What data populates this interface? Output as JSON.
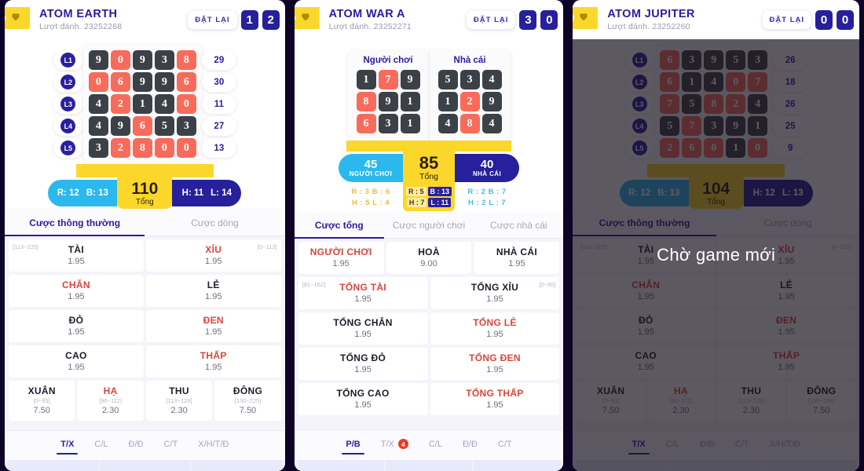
{
  "panels": [
    {
      "id": "atom-earth",
      "header": {
        "title": "ATOM EARTH",
        "subtitle": "Lượt đánh. 23252268",
        "reset_label": "ĐẶT LẠI",
        "score_left": "1",
        "score_right": "2"
      },
      "board": {
        "type": "grid5",
        "row_labels": [
          "L1",
          "L2",
          "L3",
          "L4",
          "L5"
        ],
        "rows": [
          {
            "cells": [
              {
                "v": "9",
                "c": "dark"
              },
              {
                "v": "0",
                "c": "red"
              },
              {
                "v": "9",
                "c": "dark"
              },
              {
                "v": "3",
                "c": "dark"
              },
              {
                "v": "8",
                "c": "red"
              }
            ],
            "sum": "29"
          },
          {
            "cells": [
              {
                "v": "0",
                "c": "red"
              },
              {
                "v": "6",
                "c": "red"
              },
              {
                "v": "9",
                "c": "dark"
              },
              {
                "v": "9",
                "c": "dark"
              },
              {
                "v": "6",
                "c": "red"
              }
            ],
            "sum": "30"
          },
          {
            "cells": [
              {
                "v": "4",
                "c": "dark"
              },
              {
                "v": "2",
                "c": "red"
              },
              {
                "v": "1",
                "c": "dark"
              },
              {
                "v": "4",
                "c": "dark"
              },
              {
                "v": "0",
                "c": "red"
              }
            ],
            "sum": "11"
          },
          {
            "cells": [
              {
                "v": "4",
                "c": "dark"
              },
              {
                "v": "9",
                "c": "dark"
              },
              {
                "v": "6",
                "c": "red"
              },
              {
                "v": "5",
                "c": "dark"
              },
              {
                "v": "3",
                "c": "dark"
              }
            ],
            "sum": "27"
          },
          {
            "cells": [
              {
                "v": "3",
                "c": "dark"
              },
              {
                "v": "2",
                "c": "red"
              },
              {
                "v": "8",
                "c": "red"
              },
              {
                "v": "0",
                "c": "red"
              },
              {
                "v": "0",
                "c": "red"
              }
            ],
            "sum": "13"
          }
        ],
        "total": "110",
        "total_label": "Tổng",
        "left_stat_a": "R: 12",
        "left_stat_b": "B: 13",
        "right_stat_a": "H: 11",
        "right_stat_b": "L: 14"
      },
      "tabs": [
        {
          "label": "Cược thông thường",
          "active": true
        },
        {
          "label": "Cược dòng",
          "active": false
        }
      ],
      "bets": [
        [
          {
            "name": "TÀI",
            "odds": "1.95",
            "red": false,
            "range_left": "[113~225]"
          },
          {
            "name": "XỈU",
            "odds": "1.95",
            "red": true,
            "range_right": "[0~112]"
          }
        ],
        [
          {
            "name": "CHẴN",
            "odds": "1.95",
            "red": true
          },
          {
            "name": "LẺ",
            "odds": "1.95",
            "red": false
          }
        ],
        [
          {
            "name": "ĐỎ",
            "odds": "1.95",
            "red": false
          },
          {
            "name": "ĐEN",
            "odds": "1.95",
            "red": true
          }
        ],
        [
          {
            "name": "CAO",
            "odds": "1.95",
            "red": false
          },
          {
            "name": "THẤP",
            "odds": "1.95",
            "red": true
          }
        ],
        [
          {
            "name": "XUÂN",
            "odds": "7.50",
            "red": false,
            "range_center": "[0~95]"
          },
          {
            "name": "HẠ",
            "odds": "2.30",
            "red": true,
            "range_center": "[96~112]"
          },
          {
            "name": "THU",
            "odds": "2.30",
            "red": false,
            "range_center": "[113~129]"
          },
          {
            "name": "ĐÔNG",
            "odds": "7.50",
            "red": false,
            "range_center": "[130~225]"
          }
        ]
      ],
      "bottom_tabs": [
        {
          "label": "T/X",
          "active": true
        },
        {
          "label": "C/L",
          "active": false
        },
        {
          "label": "Đ/Đ",
          "active": false
        },
        {
          "label": "C/T",
          "active": false
        },
        {
          "label": "X/H/T/Đ",
          "active": false
        }
      ],
      "overlay": null
    },
    {
      "id": "atom-war-a",
      "header": {
        "title": "ATOM WAR A",
        "subtitle": "Lượt đánh. 23252271",
        "reset_label": "ĐẶT LẠI",
        "score_left": "3",
        "score_right": "0"
      },
      "board": {
        "type": "war",
        "player_title": "Người chơi",
        "banker_title": "Nhà cái",
        "player_rows": [
          [
            {
              "v": "1",
              "c": "dark"
            },
            {
              "v": "7",
              "c": "red"
            },
            {
              "v": "9",
              "c": "dark"
            }
          ],
          [
            {
              "v": "8",
              "c": "red"
            },
            {
              "v": "9",
              "c": "dark"
            },
            {
              "v": "1",
              "c": "dark"
            }
          ],
          [
            {
              "v": "6",
              "c": "red"
            },
            {
              "v": "3",
              "c": "dark"
            },
            {
              "v": "1",
              "c": "dark"
            }
          ]
        ],
        "banker_rows": [
          [
            {
              "v": "5",
              "c": "dark"
            },
            {
              "v": "3",
              "c": "dark"
            },
            {
              "v": "4",
              "c": "dark"
            }
          ],
          [
            {
              "v": "1",
              "c": "dark"
            },
            {
              "v": "2",
              "c": "red"
            },
            {
              "v": "9",
              "c": "dark"
            }
          ],
          [
            {
              "v": "4",
              "c": "dark"
            },
            {
              "v": "8",
              "c": "red"
            },
            {
              "v": "4",
              "c": "dark"
            }
          ]
        ],
        "player_score": "45",
        "player_score_label": "NGƯỜI CHƠI",
        "banker_score": "40",
        "banker_score_label": "NHÀ CÁI",
        "total": "85",
        "total_label": "Tổng",
        "player_stats": [
          "R : 3  B : 6",
          "H : 5  L : 4"
        ],
        "banker_stats": [
          "R : 2  B : 7",
          "H : 2  L : 7"
        ],
        "mid_stats": [
          {
            "a": "R : 5",
            "b": "B : 13"
          },
          {
            "a": "H : 7",
            "b": "L : 11"
          }
        ]
      },
      "tabs": [
        {
          "label": "Cược tổng",
          "active": true
        },
        {
          "label": "Cược người chơi",
          "active": false
        },
        {
          "label": "Cược nhà cái",
          "active": false
        }
      ],
      "bets": [
        [
          {
            "name": "NGƯỜI CHƠI",
            "odds": "1.95",
            "red": true
          },
          {
            "name": "HOÀ",
            "odds": "9.00",
            "red": false
          },
          {
            "name": "NHÀ CÁI",
            "odds": "1.95",
            "red": false
          }
        ],
        [
          {
            "name": "TỔNG TÀI",
            "odds": "1.95",
            "red": true,
            "range_left": "[81~162]"
          },
          {
            "name": "TỔNG XỈU",
            "odds": "1.95",
            "red": false,
            "range_right": "[0~80]"
          }
        ],
        [
          {
            "name": "TỔNG CHẴN",
            "odds": "1.95",
            "red": false
          },
          {
            "name": "TỔNG LẺ",
            "odds": "1.95",
            "red": true
          }
        ],
        [
          {
            "name": "TỔNG ĐỎ",
            "odds": "1.95",
            "red": false
          },
          {
            "name": "TỔNG ĐEN",
            "odds": "1.95",
            "red": true
          }
        ],
        [
          {
            "name": "TỔNG CAO",
            "odds": "1.95",
            "red": false
          },
          {
            "name": "TỔNG THẤP",
            "odds": "1.95",
            "red": true
          }
        ]
      ],
      "bottom_tabs": [
        {
          "label": "P/B",
          "active": true
        },
        {
          "label": "T/X",
          "active": false,
          "badge": "4"
        },
        {
          "label": "C/L",
          "active": false
        },
        {
          "label": "Đ/Đ",
          "active": false
        },
        {
          "label": "C/T",
          "active": false
        }
      ],
      "overlay": null
    },
    {
      "id": "atom-jupiter",
      "header": {
        "title": "ATOM JUPITER",
        "subtitle": "Lượt đánh. 23252260",
        "reset_label": "ĐẶT LẠI",
        "score_left": "0",
        "score_right": "0"
      },
      "board": {
        "type": "grid5",
        "row_labels": [
          "L1",
          "L2",
          "L3",
          "L4",
          "L5"
        ],
        "rows": [
          {
            "cells": [
              {
                "v": "6",
                "c": "red"
              },
              {
                "v": "3",
                "c": "dark"
              },
              {
                "v": "9",
                "c": "dark"
              },
              {
                "v": "5",
                "c": "dark"
              },
              {
                "v": "3",
                "c": "dark"
              }
            ],
            "sum": "26"
          },
          {
            "cells": [
              {
                "v": "6",
                "c": "red"
              },
              {
                "v": "1",
                "c": "dark"
              },
              {
                "v": "4",
                "c": "dark"
              },
              {
                "v": "0",
                "c": "red"
              },
              {
                "v": "7",
                "c": "red"
              }
            ],
            "sum": "18"
          },
          {
            "cells": [
              {
                "v": "7",
                "c": "red"
              },
              {
                "v": "5",
                "c": "dark"
              },
              {
                "v": "8",
                "c": "red"
              },
              {
                "v": "2",
                "c": "red"
              },
              {
                "v": "4",
                "c": "dark"
              }
            ],
            "sum": "26"
          },
          {
            "cells": [
              {
                "v": "5",
                "c": "dark"
              },
              {
                "v": "7",
                "c": "red"
              },
              {
                "v": "3",
                "c": "dark"
              },
              {
                "v": "9",
                "c": "dark"
              },
              {
                "v": "1",
                "c": "dark"
              }
            ],
            "sum": "25"
          },
          {
            "cells": [
              {
                "v": "2",
                "c": "red"
              },
              {
                "v": "6",
                "c": "red"
              },
              {
                "v": "0",
                "c": "red"
              },
              {
                "v": "1",
                "c": "dark"
              },
              {
                "v": "0",
                "c": "red"
              }
            ],
            "sum": "9"
          }
        ],
        "total": "104",
        "total_label": "Tổng",
        "left_stat_a": "R: 12",
        "left_stat_b": "B: 13",
        "right_stat_a": "H: 12",
        "right_stat_b": "L: 13"
      },
      "tabs": [
        {
          "label": "Cược thông thường",
          "active": true
        },
        {
          "label": "Cược dòng",
          "active": false
        }
      ],
      "bets": [
        [
          {
            "name": "TÀI",
            "odds": "1.95",
            "red": false,
            "range_left": "[113~225]"
          },
          {
            "name": "XỈU",
            "odds": "1.95",
            "red": true,
            "range_right": "[0~112]"
          }
        ],
        [
          {
            "name": "CHẴN",
            "odds": "1.95",
            "red": true
          },
          {
            "name": "LẺ",
            "odds": "1.95",
            "red": false
          }
        ],
        [
          {
            "name": "ĐỎ",
            "odds": "1.95",
            "red": false
          },
          {
            "name": "ĐEN",
            "odds": "1.95",
            "red": true
          }
        ],
        [
          {
            "name": "CAO",
            "odds": "1.95",
            "red": false
          },
          {
            "name": "THẤP",
            "odds": "1.95",
            "red": true
          }
        ],
        [
          {
            "name": "XUÂN",
            "odds": "7.50",
            "red": false,
            "range_center": "[0~95]"
          },
          {
            "name": "HẠ",
            "odds": "2.30",
            "red": true,
            "range_center": "[96~112]"
          },
          {
            "name": "THU",
            "odds": "2.30",
            "red": false,
            "range_center": "[113~129]"
          },
          {
            "name": "ĐÔNG",
            "odds": "7.50",
            "red": false,
            "range_center": "[130~225]"
          }
        ]
      ],
      "bottom_tabs": [
        {
          "label": "T/X",
          "active": true
        },
        {
          "label": "C/L",
          "active": false
        },
        {
          "label": "Đ/Đ",
          "active": false
        },
        {
          "label": "C/T",
          "active": false
        },
        {
          "label": "X/H/T/Đ",
          "active": false
        }
      ],
      "overlay": "Chờ game mới"
    }
  ],
  "colors": {
    "background": "#0d0326",
    "brand": "#2e1a9e",
    "accent_yellow": "#fbd72b",
    "accent_cyan": "#2bb8ee",
    "accent_navy": "#26209c",
    "cell_dark": "#3c4147",
    "cell_red": "#f86b5b",
    "bet_red": "#d9453c",
    "badge_red": "#f03a22"
  }
}
